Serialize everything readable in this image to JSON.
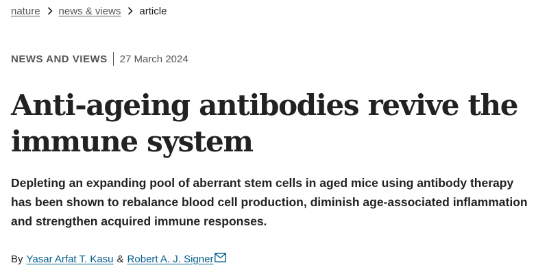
{
  "breadcrumb": {
    "items": [
      {
        "label": "nature",
        "link": true
      },
      {
        "label": "news & views",
        "link": true
      },
      {
        "label": "article",
        "link": false
      }
    ]
  },
  "article": {
    "type": "NEWS AND VIEWS",
    "date": "27 March 2024",
    "title": "Anti-ageing antibodies revive the immune system",
    "standfirst": "Depleting an expanding pool of aberrant stem cells in aged mice using antibody therapy has been shown to rebalance blood cell production, diminish age-associated inflammation and strengthen acquired immune responses.",
    "byline": {
      "by_label": "By",
      "separator": "&",
      "authors": [
        {
          "name": "Yasar Arfat T. Kasu"
        },
        {
          "name": "Robert A. J. Signer",
          "contact_icon": "envelope-icon"
        }
      ]
    }
  },
  "colors": {
    "text": "#222222",
    "muted": "#555555",
    "author_link": "#025e8d"
  }
}
